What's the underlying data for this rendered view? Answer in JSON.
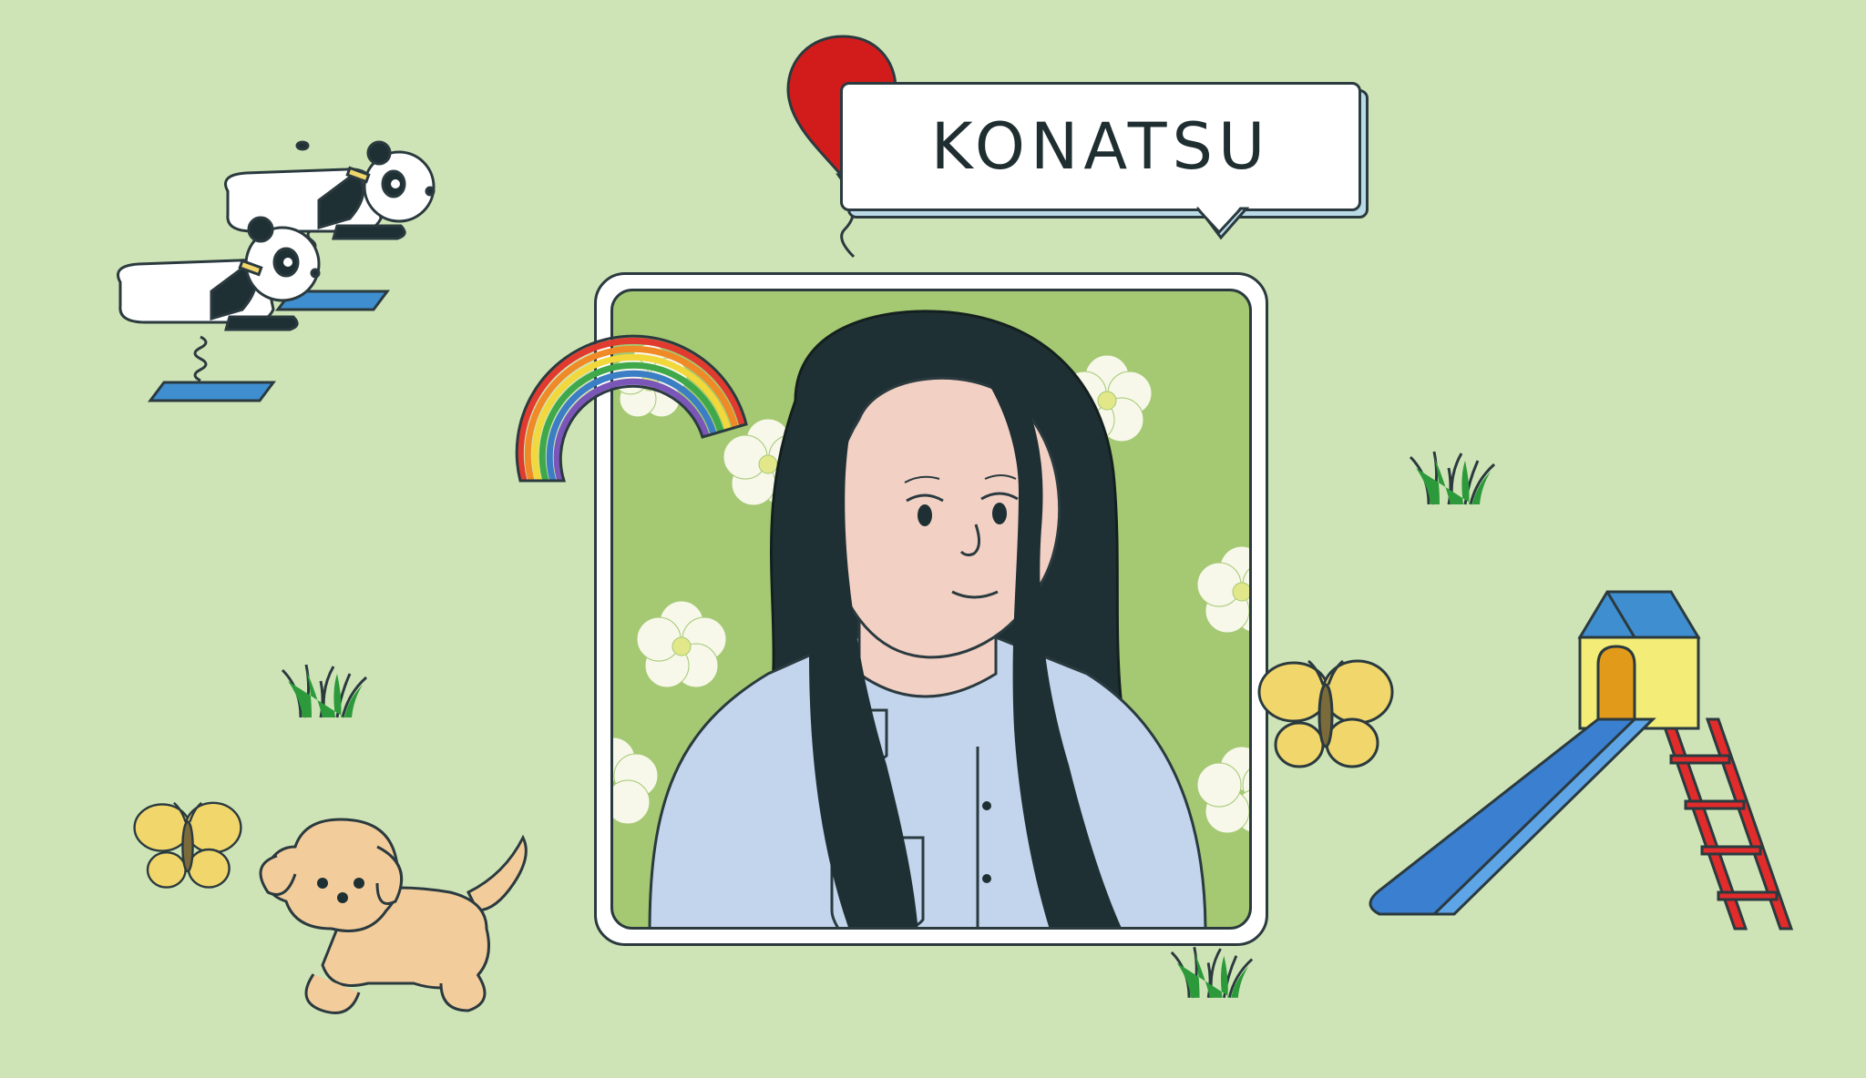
{
  "name_tag": {
    "name": "KONATSU"
  },
  "colors": {
    "background": "#cfe4b6",
    "portrait_background": "#a4c972",
    "hair": "#1f3035",
    "skin": "#f2d0c4",
    "shirt": "#c3d5ec",
    "balloon": "#d21c1c",
    "butterfly": "#f1d66b",
    "dog": "#f3cc9b",
    "slide_blue": "#3a7fd0",
    "slide_ladder": "#e22b2b",
    "house_yellow": "#f3ec77",
    "grass": "#2c9a3a"
  },
  "icons": [
    "balloon-icon",
    "panda-spring-rider-icon",
    "rainbow-icon",
    "grass-tuft-icon",
    "butterfly-icon",
    "dog-icon",
    "playground-slide-icon",
    "flower-icon"
  ]
}
